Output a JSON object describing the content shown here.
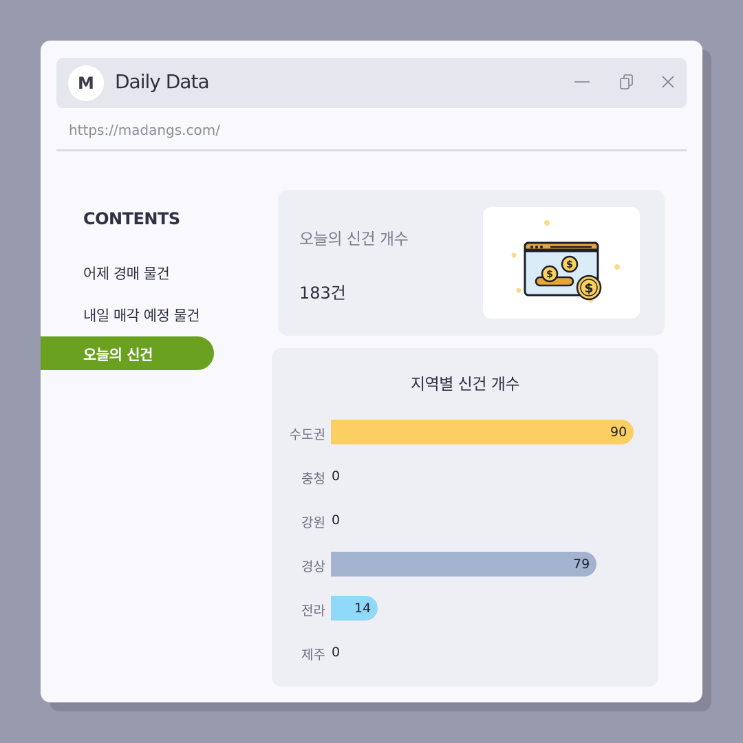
{
  "window": {
    "avatar_letter": "M",
    "title": "Daily Data",
    "url": "https://madangs.com/"
  },
  "sidebar": {
    "heading": "CONTENTS",
    "items": [
      {
        "label": "어제 경매 물건"
      },
      {
        "label": "내일 매각 예정 물건"
      },
      {
        "label": "오늘의 신건",
        "active": true
      }
    ],
    "active_color": "#6aa121"
  },
  "summary": {
    "label": "오늘의 신건 개수",
    "value": "183건",
    "icon": "money-window-icon"
  },
  "chart_data": {
    "type": "bar",
    "orientation": "horizontal",
    "title": "지역별 신건 개수",
    "categories": [
      "수도권",
      "충청",
      "강원",
      "경상",
      "전라",
      "제주"
    ],
    "values": [
      90,
      0,
      0,
      79,
      14,
      0
    ],
    "colors": [
      "#fcce64",
      "#fcce64",
      "#fcce64",
      "#a3b3cf",
      "#91d9f8",
      "#91d9f8"
    ],
    "xlim": [
      0,
      90
    ],
    "grid": false
  }
}
